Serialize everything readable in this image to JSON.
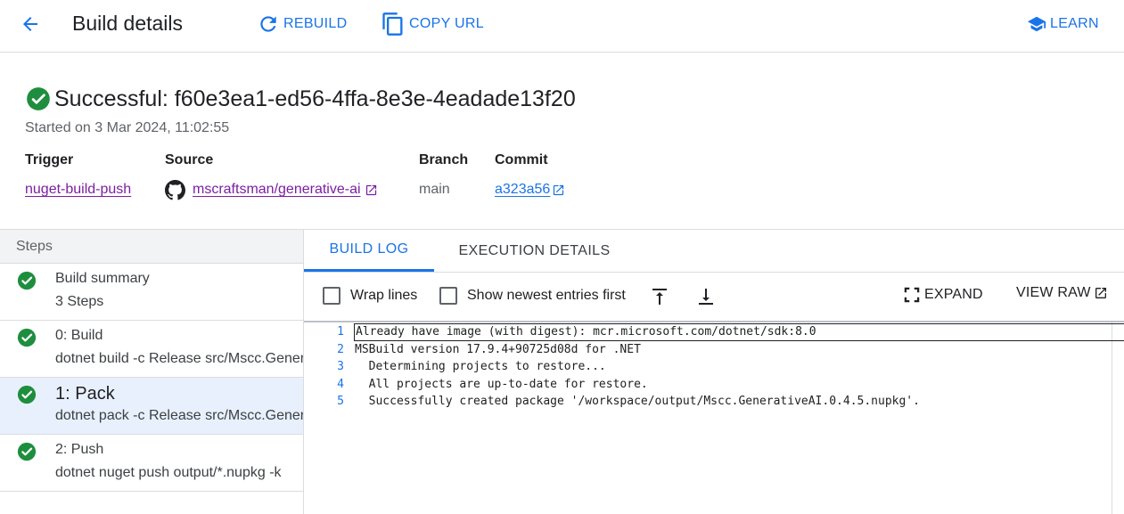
{
  "header": {
    "title": "Build details",
    "rebuild_label": "REBUILD",
    "copy_url_label": "COPY URL",
    "learn_label": "LEARN"
  },
  "build": {
    "status_title": "Successful: f60e3ea1-ed56-4ffa-8e3e-4eadade13f20",
    "started": "Started on 3 Mar 2024, 11:02:55",
    "trigger_label": "Trigger",
    "trigger_value": "nuget-build-push",
    "source_label": "Source",
    "source_value": "mscraftsman/generative-ai",
    "branch_label": "Branch",
    "branch_value": "main",
    "commit_label": "Commit",
    "commit_value": "a323a56"
  },
  "steps": {
    "header": "Steps",
    "items": [
      {
        "title": "Build summary",
        "subtitle": "3 Steps",
        "status": "success"
      },
      {
        "title": "0: Build",
        "subtitle": "dotnet build -c Release src/Mscc.GenerativeAI",
        "status": "success"
      },
      {
        "title": "1: Pack",
        "subtitle": "dotnet pack -c Release src/Mscc.GenerativeAI",
        "status": "success"
      },
      {
        "title": "2: Push",
        "subtitle": "dotnet nuget push output/*.nupkg -k",
        "status": "success"
      }
    ]
  },
  "log": {
    "tabs": [
      "BUILD LOG",
      "EXECUTION DETAILS"
    ],
    "active_tab": 0,
    "wrap_lines_label": "Wrap lines",
    "newest_first_label": "Show newest entries first",
    "wrap_lines_checked": false,
    "newest_first_checked": false,
    "expand_label": "EXPAND",
    "view_raw_label": "VIEW RAW",
    "lines": [
      {
        "n": "1",
        "text": "Already have image (with digest): mcr.microsoft.com/dotnet/sdk:8.0"
      },
      {
        "n": "2",
        "text": "MSBuild version 17.9.4+90725d08d for .NET"
      },
      {
        "n": "3",
        "text": "  Determining projects to restore..."
      },
      {
        "n": "4",
        "text": "  All projects are up-to-date for restore."
      },
      {
        "n": "5",
        "text": "  Successfully created package '/workspace/output/Mscc.GenerativeAI.0.4.5.nupkg'."
      }
    ]
  },
  "colors": {
    "accent": "#1a73e8",
    "success": "#1e8e3e",
    "link_visited": "#7b1fa2",
    "active_step_bg": "#e8f0fe"
  },
  "icons": {
    "back": "arrow-back-icon",
    "rebuild": "refresh-icon",
    "copy": "copy-icon",
    "learn": "school-icon",
    "status": "check-circle-icon",
    "github": "github-icon",
    "external": "open-in-new-icon",
    "scroll_top": "vertical-align-top-icon",
    "scroll_bottom": "vertical-align-bottom-icon",
    "expand": "fullscreen-icon"
  }
}
